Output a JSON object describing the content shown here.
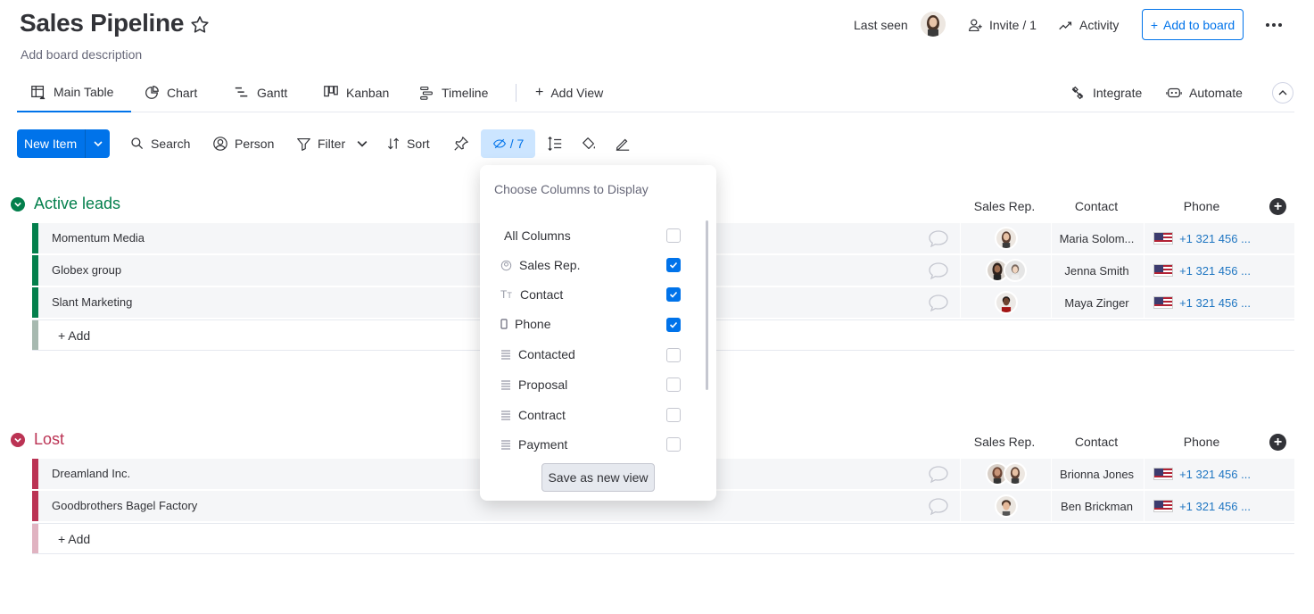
{
  "board": {
    "title": "Sales Pipeline",
    "description": "Add board description"
  },
  "header": {
    "last_seen": "Last seen",
    "invite": "Invite / 1",
    "activity": "Activity",
    "add_to_board": "Add to board"
  },
  "views": [
    {
      "label": "Main Table",
      "icon": "table-home-icon",
      "active": true
    },
    {
      "label": "Chart",
      "icon": "chart-icon"
    },
    {
      "label": "Gantt",
      "icon": "gantt-icon"
    },
    {
      "label": "Kanban",
      "icon": "kanban-icon"
    },
    {
      "label": "Timeline",
      "icon": "timeline-icon"
    },
    {
      "label": "Add View",
      "icon": "plus-icon"
    }
  ],
  "integrations": {
    "integrate": "Integrate",
    "automate": "Automate"
  },
  "toolbar": {
    "new_item": "New Item",
    "search": "Search",
    "person": "Person",
    "filter": "Filter",
    "sort": "Sort",
    "hidden_count": "/ 7"
  },
  "columns": {
    "sales_rep": "Sales Rep.",
    "contact": "Contact",
    "phone": "Phone"
  },
  "groups": [
    {
      "name": "Active leads",
      "color": "#037f4c",
      "items": [
        {
          "name": "Momentum Media",
          "contact": "Maria Solom...",
          "phone": "+1 321 456 ..."
        },
        {
          "name": "Globex group",
          "contact": "Jenna Smith",
          "phone": "+1 321 456 ..."
        },
        {
          "name": "Slant Marketing",
          "contact": "Maya Zinger",
          "phone": "+1 321 456 ..."
        }
      ],
      "add_label": "+ Add"
    },
    {
      "name": "Lost",
      "color": "#bb3354",
      "items": [
        {
          "name": "Dreamland Inc.",
          "contact": "Brionna Jones",
          "phone": "+1 321 456 ..."
        },
        {
          "name": "Goodbrothers Bagel Factory",
          "contact": "Ben Brickman",
          "phone": "+1 321 456 ..."
        }
      ],
      "add_label": "+ Add"
    }
  ],
  "dropdown": {
    "title": "Choose Columns to Display",
    "items": [
      {
        "label": "All Columns",
        "checked": false
      },
      {
        "label": "Sales Rep.",
        "icon": "person-icon",
        "checked": true
      },
      {
        "label": "Contact",
        "icon": "text-icon",
        "checked": true
      },
      {
        "label": "Phone",
        "icon": "phone-icon",
        "checked": true
      },
      {
        "label": "Contacted",
        "icon": "status-icon",
        "checked": false
      },
      {
        "label": "Proposal",
        "icon": "status-icon",
        "checked": false
      },
      {
        "label": "Contract",
        "icon": "status-icon",
        "checked": false
      },
      {
        "label": "Payment",
        "icon": "status-icon",
        "checked": false
      }
    ],
    "save_label": "Save as new view"
  }
}
